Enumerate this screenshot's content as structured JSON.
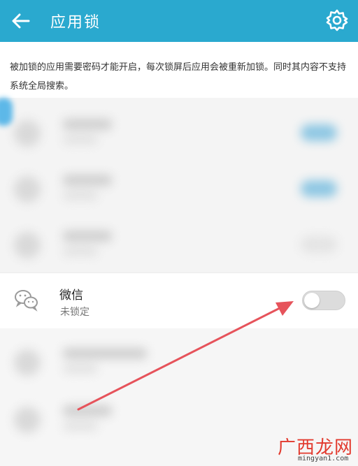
{
  "header": {
    "title": "应用锁",
    "back_icon": "back-arrow-icon",
    "settings_icon": "gear-icon",
    "bg_color": "#2aa9cf"
  },
  "notice": {
    "text": "被加锁的应用需要密码才能开启，每次锁屏后应用会被重新加锁。同时其内容不支持系统全局搜索。"
  },
  "app_row": {
    "name": "微信",
    "status": "未锁定",
    "icon": "wechat-icon",
    "toggle_on": false
  },
  "annotation": {
    "arrow_color": "#e6535b"
  },
  "watermark": {
    "main": "广西龙网",
    "url": "mingyan1.com"
  }
}
